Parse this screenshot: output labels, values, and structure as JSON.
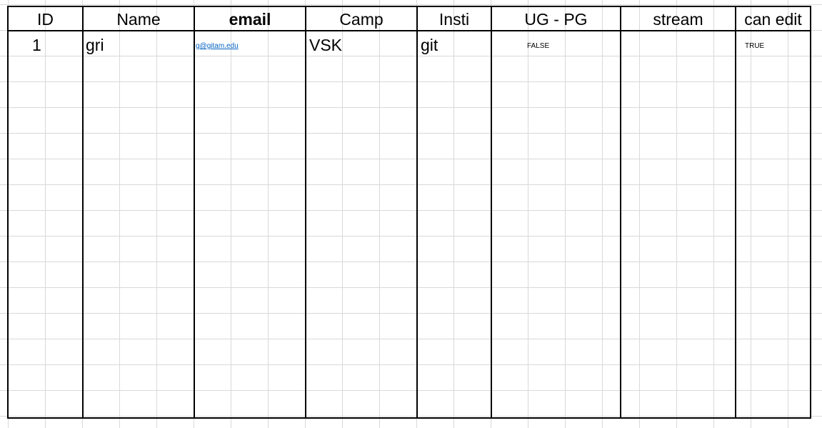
{
  "headers": {
    "id": "ID",
    "name": "Name",
    "email": "email",
    "camp": "Camp",
    "insti": "Insti",
    "ug_pg": "UG - PG",
    "stream": "stream",
    "can_edit": "can edit"
  },
  "rows": [
    {
      "id": "1",
      "name": "gri",
      "email": "g@gitam.edu",
      "camp": "VSK",
      "insti": "git",
      "ug_pg": "FALSE",
      "stream": "",
      "can_edit": "TRUE"
    }
  ],
  "colors": {
    "gridline": "#d9d9d9",
    "border": "#000000",
    "hyperlink": "#0563c1"
  }
}
